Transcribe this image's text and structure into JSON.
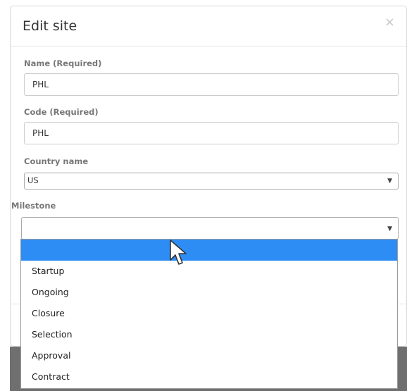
{
  "modal": {
    "title": "Edit site",
    "close_glyph": "×"
  },
  "fields": {
    "name": {
      "label": "Name  (Required)",
      "value": "PHL"
    },
    "code": {
      "label": "Code  (Required)",
      "value": "PHL"
    },
    "country": {
      "label": "Country name",
      "value": "US"
    },
    "milestone": {
      "label": "Milestone",
      "value": ""
    }
  },
  "milestone_options": [
    "",
    "Startup",
    "Ongoing",
    "Closure",
    "Selection",
    "Approval",
    "Contract"
  ],
  "colors": {
    "highlight": "#2e8df5",
    "label": "#777777",
    "backdrop": "#6f6f6f"
  },
  "icons": {
    "close": "close-icon",
    "caret": "chevron-down-icon",
    "cursor": "mouse-pointer-icon"
  }
}
